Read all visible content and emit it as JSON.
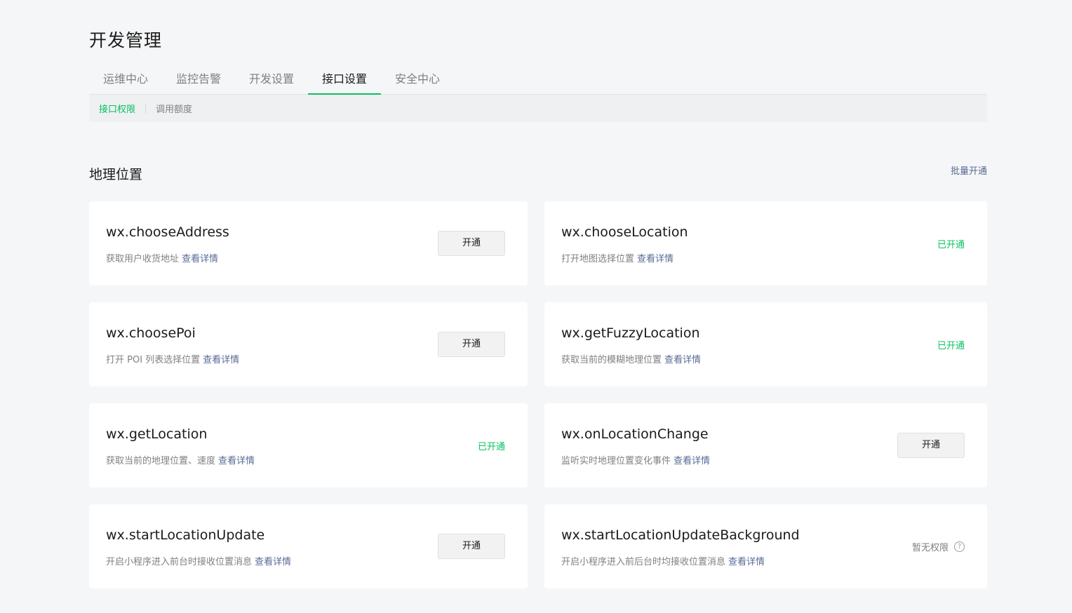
{
  "page": {
    "title": "开发管理"
  },
  "tabs": [
    {
      "label": "运维中心"
    },
    {
      "label": "监控告警"
    },
    {
      "label": "开发设置"
    },
    {
      "label": "接口设置",
      "active": true
    },
    {
      "label": "安全中心"
    }
  ],
  "subtabs": [
    {
      "label": "接口权限",
      "active": true
    },
    {
      "label": "调用额度"
    }
  ],
  "section": {
    "title": "地理位置",
    "batch_label": "批量开通"
  },
  "link_label": "查看详情",
  "open_button_label": "开通",
  "opened_label": "已开通",
  "no_permission_label": "暂无权限",
  "help_icon_glyph": "?",
  "apis": [
    {
      "name": "wx.chooseAddress",
      "desc": "获取用户收货地址",
      "status": "open-button"
    },
    {
      "name": "wx.chooseLocation",
      "desc": "打开地图选择位置",
      "status": "opened"
    },
    {
      "name": "wx.choosePoi",
      "desc": "打开 POI 列表选择位置",
      "status": "open-button"
    },
    {
      "name": "wx.getFuzzyLocation",
      "desc": "获取当前的模糊地理位置",
      "status": "opened"
    },
    {
      "name": "wx.getLocation",
      "desc": "获取当前的地理位置、速度",
      "status": "opened"
    },
    {
      "name": "wx.onLocationChange",
      "desc": "监听实时地理位置变化事件",
      "status": "open-button"
    },
    {
      "name": "wx.startLocationUpdate",
      "desc": "开启小程序进入前台时接收位置消息",
      "status": "open-button"
    },
    {
      "name": "wx.startLocationUpdateBackground",
      "desc": "开启小程序进入前后台时均接收位置消息",
      "status": "no-permission"
    }
  ],
  "colors": {
    "accent": "#07c160",
    "link": "#576b95",
    "background": "#f5f6f7"
  }
}
